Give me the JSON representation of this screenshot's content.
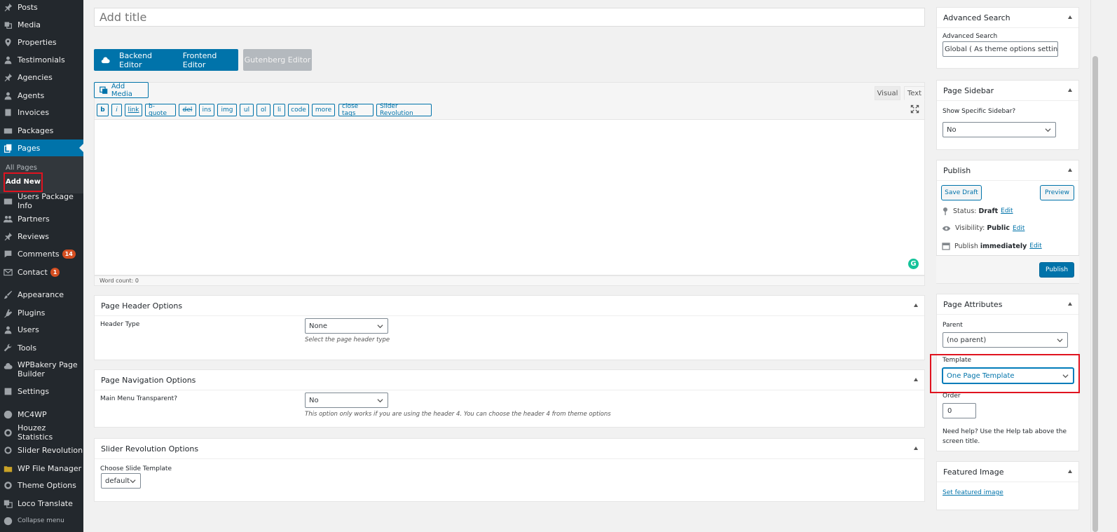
{
  "sidebar": {
    "items": [
      {
        "label": "Posts",
        "icon": "pin-icon"
      },
      {
        "label": "Media",
        "icon": "media-icon"
      },
      {
        "label": "Properties",
        "icon": "location-icon"
      },
      {
        "label": "Testimonials",
        "icon": "user-icon"
      },
      {
        "label": "Agencies",
        "icon": "pin-icon"
      },
      {
        "label": "Agents",
        "icon": "user-icon"
      },
      {
        "label": "Invoices",
        "icon": "book-icon"
      },
      {
        "label": "Packages",
        "icon": "card-icon"
      },
      {
        "label": "Pages",
        "icon": "pages-icon"
      },
      {
        "label": "Users Package Info",
        "icon": "id-card-icon"
      },
      {
        "label": "Partners",
        "icon": "group-icon"
      },
      {
        "label": "Reviews",
        "icon": "pin-icon"
      },
      {
        "label": "Comments",
        "icon": "comment-icon",
        "badge": "14"
      },
      {
        "label": "Contact",
        "icon": "mail-icon",
        "badge": "1"
      },
      {
        "label": "Appearance",
        "icon": "brush-icon"
      },
      {
        "label": "Plugins",
        "icon": "plugin-icon"
      },
      {
        "label": "Users",
        "icon": "user-icon"
      },
      {
        "label": "Tools",
        "icon": "wrench-icon"
      },
      {
        "label": "WPBakery Page Builder",
        "icon": "cloud-icon"
      },
      {
        "label": "Settings",
        "icon": "settings-icon"
      },
      {
        "label": "MC4WP",
        "icon": "mc4wp-icon"
      },
      {
        "label": "Houzez Statistics",
        "icon": "gear-icon"
      },
      {
        "label": "Slider Revolution",
        "icon": "refresh-icon"
      },
      {
        "label": "WP File Manager",
        "icon": "folder-icon"
      },
      {
        "label": "Theme Options",
        "icon": "gear-icon"
      },
      {
        "label": "Loco Translate",
        "icon": "translate-icon"
      },
      {
        "label": "Collapse menu",
        "icon": "collapse-icon"
      }
    ],
    "submenu": {
      "all_pages": "All Pages",
      "add_new": "Add New"
    }
  },
  "title": {
    "placeholder": "Add title"
  },
  "editor_buttons": {
    "backend": "Backend Editor",
    "frontend": "Frontend Editor",
    "gutenberg": "Gutenberg Editor"
  },
  "editor": {
    "add_media": "Add Media",
    "tabs": {
      "visual": "Visual",
      "text": "Text"
    },
    "quicktags": [
      "b",
      "i",
      "link",
      "b-quote",
      "del",
      "ins",
      "img",
      "ul",
      "ol",
      "li",
      "code",
      "more",
      "close tags",
      "Slider Revolution"
    ],
    "word_count": "Word count: 0",
    "grammarly": "G"
  },
  "page_header": {
    "title": "Page Header Options",
    "label": "Header Type",
    "value": "None",
    "hint": "Select the page header type"
  },
  "page_nav": {
    "title": "Page Navigation Options",
    "label": "Main Menu Transparent?",
    "value": "No",
    "hint": "This option only works if you are using the header 4. You can choose the header 4 from theme options"
  },
  "slider_rev": {
    "title": "Slider Revolution Options",
    "label": "Choose Slide Template",
    "value": "default"
  },
  "advanced_search": {
    "title": "Advanced Search",
    "label": "Advanced Search",
    "value": "Global ( As theme options settings )"
  },
  "page_sidebar": {
    "title": "Page Sidebar",
    "label": "Show Specific Sidebar?",
    "value": "No"
  },
  "publish": {
    "title": "Publish",
    "save_draft": "Save Draft",
    "preview": "Preview",
    "status_label": "Status:",
    "status_value": "Draft",
    "visibility_label": "Visibility:",
    "visibility_value": "Public",
    "publish_label": "Publish",
    "publish_value": "immediately",
    "edit": "Edit",
    "publish_button": "Publish"
  },
  "page_attributes": {
    "title": "Page Attributes",
    "parent_label": "Parent",
    "parent_value": "(no parent)",
    "template_label": "Template",
    "template_value": "One Page Template",
    "order_label": "Order",
    "order_value": "0",
    "help": "Need help? Use the Help tab above the screen title."
  },
  "featured_image": {
    "title": "Featured Image",
    "link": "Set featured image"
  },
  "colors": {
    "accent": "#0073aa",
    "sidebar": "#23282d",
    "highlight": "#e0131f"
  }
}
